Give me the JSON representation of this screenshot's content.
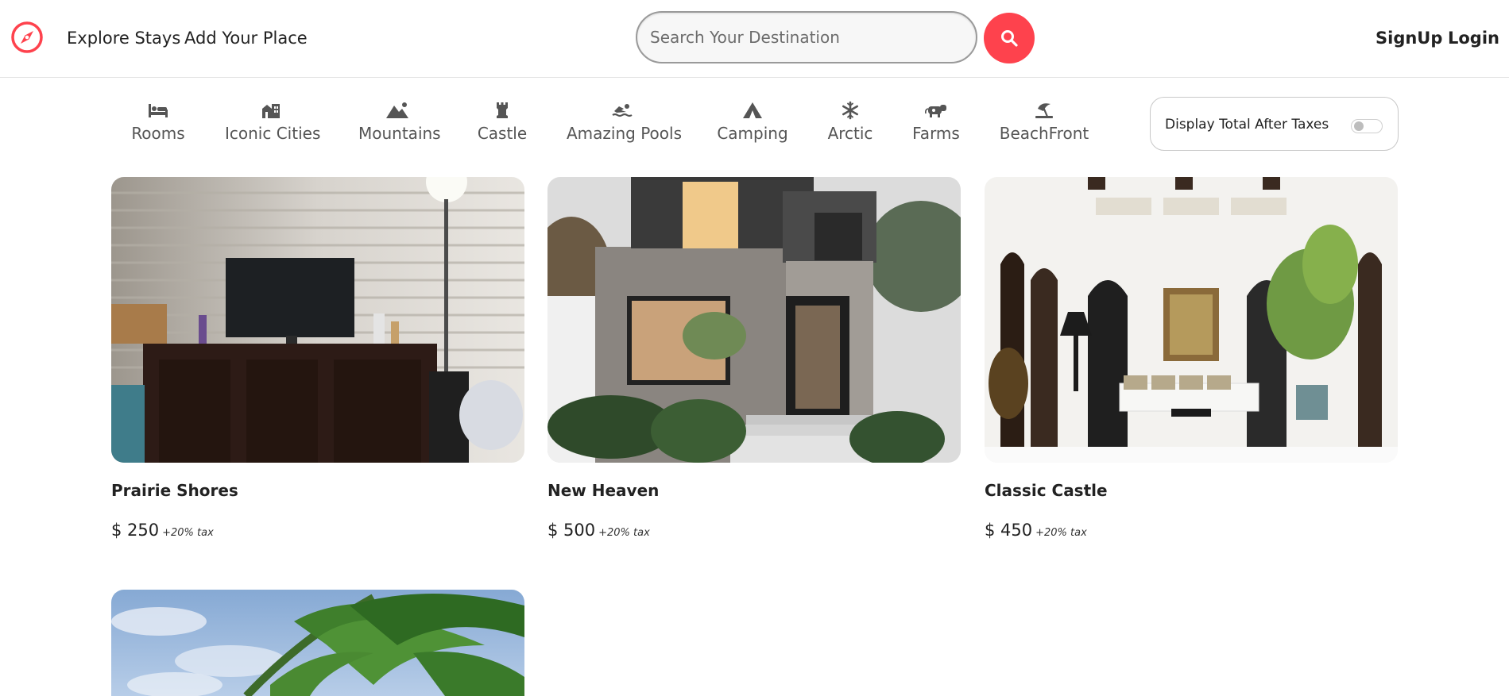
{
  "navbar": {
    "brand_icon": "compass-icon",
    "brand_color": "#fe424d",
    "links": {
      "explore": "Explore Stays",
      "add": "Add Your Place"
    },
    "search": {
      "placeholder": "Search Your Destination",
      "value": "",
      "button_icon": "search-icon"
    },
    "auth": {
      "signup": "SignUp",
      "login": "Login"
    }
  },
  "filters": [
    {
      "label": "Rooms",
      "icon": "bed-icon"
    },
    {
      "label": "Iconic Cities",
      "icon": "city-icon"
    },
    {
      "label": "Mountains",
      "icon": "mountain-icon"
    },
    {
      "label": "Castle",
      "icon": "castle-icon"
    },
    {
      "label": "Amazing Pools",
      "icon": "swimmer-icon"
    },
    {
      "label": "Camping",
      "icon": "tent-icon"
    },
    {
      "label": "Arctic",
      "icon": "snowflake-icon"
    },
    {
      "label": "Farms",
      "icon": "cow-icon"
    },
    {
      "label": "BeachFront",
      "icon": "umbrella-beach-icon"
    }
  ],
  "tax_toggle": {
    "label": "Display Total After Taxes",
    "on": false
  },
  "listings": [
    {
      "title": "Prairie Shores",
      "price": "$ 250",
      "tax_note": "+20% tax",
      "image": "living-room-tv-photo"
    },
    {
      "title": "New Heaven",
      "price": "$ 500",
      "tax_note": "+20% tax",
      "image": "modern-house-photo"
    },
    {
      "title": "Classic Castle",
      "price": "$ 450",
      "tax_note": "+20% tax",
      "image": "white-hall-interior-photo"
    },
    {
      "title": "",
      "price": "",
      "tax_note": "",
      "image": "palm-tree-photo"
    }
  ]
}
